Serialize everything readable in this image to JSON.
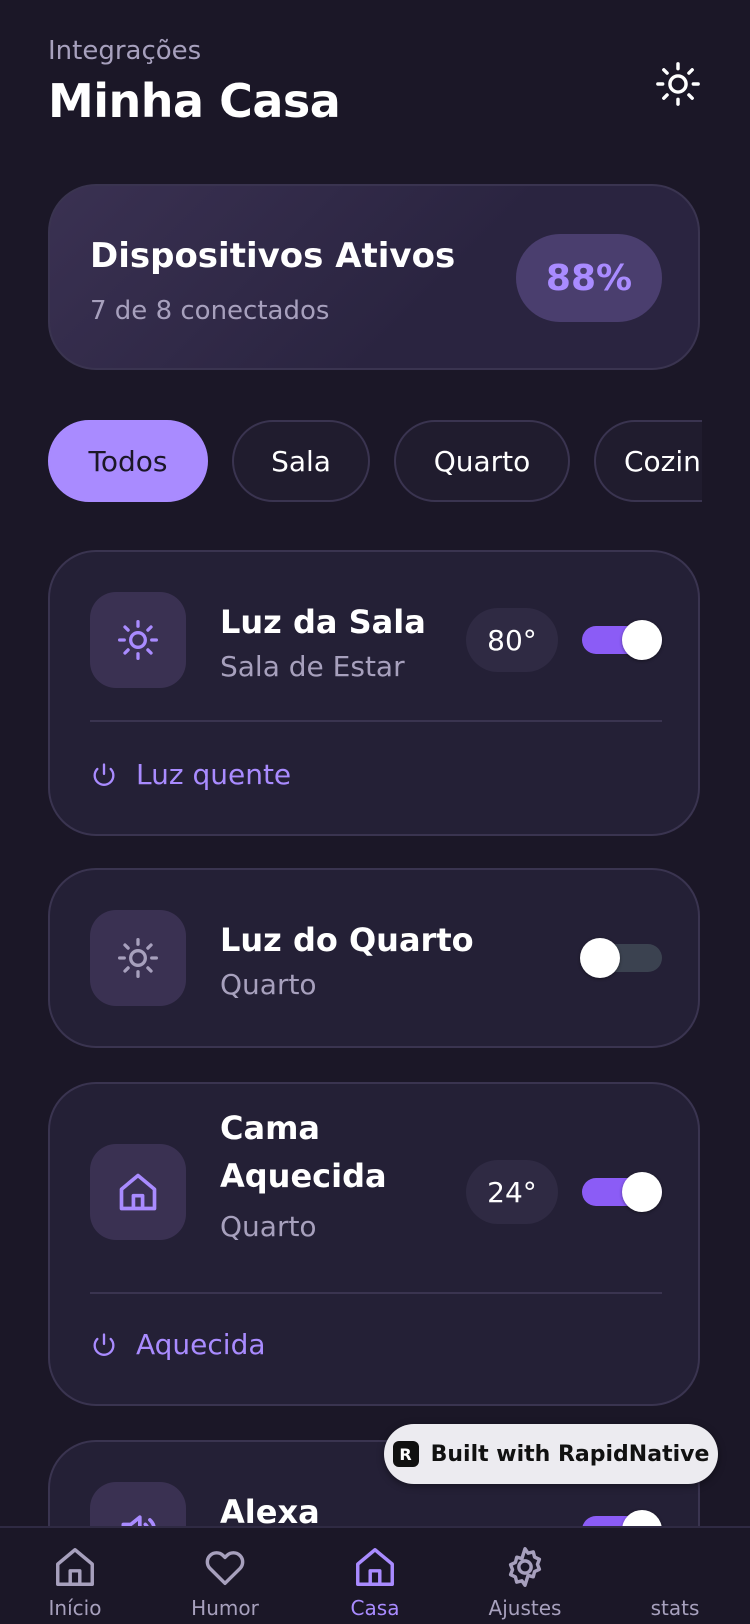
{
  "header": {
    "subtitle": "Integrações",
    "title": "Minha Casa",
    "theme_icon": "sun-icon"
  },
  "summary": {
    "title": "Dispositivos Ativos",
    "subtitle": "7 de 8 conectados",
    "percent": "88%"
  },
  "filters": [
    {
      "label": "Todos",
      "active": true
    },
    {
      "label": "Sala",
      "active": false
    },
    {
      "label": "Quarto",
      "active": false
    },
    {
      "label": "Cozinha",
      "active": false
    }
  ],
  "devices": [
    {
      "name": "Luz da Sala",
      "room": "Sala de Estar",
      "value": "80°",
      "on": true,
      "status": "Luz quente",
      "icon": "sun-icon"
    },
    {
      "name": "Luz do Quarto",
      "room": "Quarto",
      "on": false,
      "icon": "sun-icon"
    },
    {
      "name": "Cama Aquecida",
      "name_line1": "Cama",
      "name_line2": "Aquecida",
      "room": "Quarto",
      "value": "24°",
      "on": true,
      "status": "Aquecida",
      "icon": "home-icon"
    },
    {
      "name": "Alexa",
      "on": true,
      "icon": "speaker-icon"
    }
  ],
  "watermark": {
    "label": "Built with RapidNative",
    "logo": "R"
  },
  "tabs": [
    {
      "label": "Início",
      "icon": "home-icon",
      "active": false
    },
    {
      "label": "Humor",
      "icon": "heart-icon",
      "active": false
    },
    {
      "label": "Casa",
      "icon": "home-icon",
      "active": true
    },
    {
      "label": "Ajustes",
      "icon": "gear-icon",
      "active": false
    },
    {
      "label": "stats",
      "icon": "",
      "active": false
    }
  ],
  "colors": {
    "background": "#1b1727",
    "card": "#242036",
    "accent": "#a98bff",
    "toggle_on": "#8b5cf6",
    "toggle_off": "#3b4250"
  }
}
